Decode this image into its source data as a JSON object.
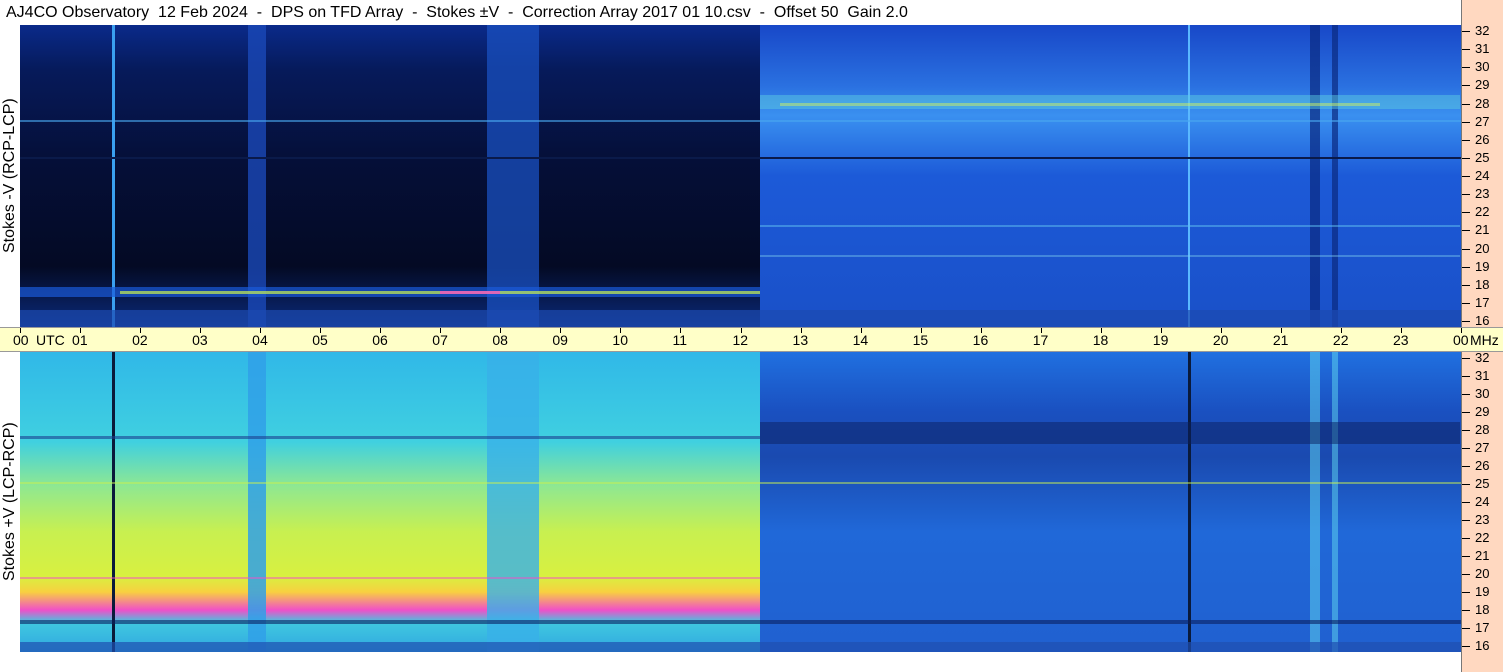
{
  "title": "AJ4CO Observatory  12 Feb 2024  -  DPS on TFD Array  -  Stokes ±V  -  Correction Array 2017 01 10.csv  -  Offset 50  Gain 2.0",
  "panels": {
    "top": {
      "label": "Stokes -V (RCP-LCP)"
    },
    "bottom": {
      "label": "Stokes +V (LCP-RCP)"
    }
  },
  "time_axis": {
    "labels": [
      "00",
      "01",
      "02",
      "03",
      "04",
      "05",
      "06",
      "07",
      "08",
      "09",
      "10",
      "11",
      "12",
      "13",
      "14",
      "15",
      "16",
      "17",
      "18",
      "19",
      "20",
      "21",
      "22",
      "23",
      "00"
    ],
    "utc_label": "UTC",
    "unit_label": "MHz"
  },
  "freq_axis": {
    "labels": [
      "32",
      "31",
      "30",
      "29",
      "28",
      "27",
      "26",
      "25",
      "24",
      "23",
      "22",
      "21",
      "20",
      "19",
      "18",
      "17",
      "16"
    ]
  },
  "colors": {
    "top_dark": "#05102a",
    "top_blue": "#1a5ad8",
    "bot_cyan": "#30c8e8",
    "bot_yellow": "#c8f050",
    "bot_magenta": "#f050c8",
    "time_axis_bg": "#ffffc8",
    "freq_axis_bg": "#ffd8c0"
  }
}
